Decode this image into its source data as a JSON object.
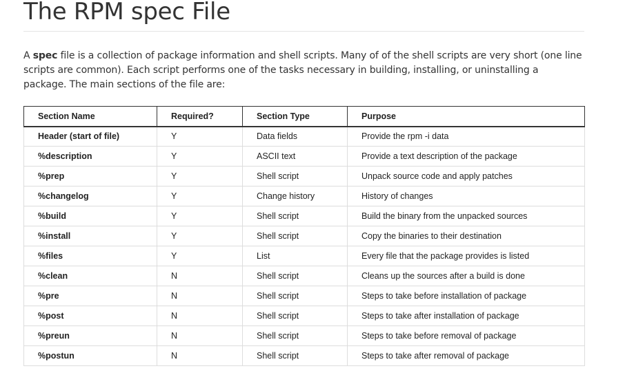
{
  "page": {
    "title": "The RPM spec File",
    "intro_prefix": "A ",
    "intro_bold": "spec",
    "intro_rest": " file is a collection of package information and shell scripts. Many of of the shell scripts are very short (one line scripts are common). Each script performs one of the tasks necessary in building, installing, or uninstalling a package. The main sections of the file are:"
  },
  "table": {
    "headers": [
      "Section Name",
      "Required?",
      "Section Type",
      "Purpose"
    ],
    "rows": [
      [
        "Header (start of file)",
        "Y",
        "Data fields",
        "Provide the rpm -i data"
      ],
      [
        "%description",
        "Y",
        "ASCII text",
        "Provide a text description of the package"
      ],
      [
        "%prep",
        "Y",
        "Shell script",
        "Unpack source code and apply patches"
      ],
      [
        "%changelog",
        "Y",
        "Change history",
        "History of changes"
      ],
      [
        "%build",
        "Y",
        "Shell script",
        "Build the binary from the unpacked sources"
      ],
      [
        "%install",
        "Y",
        "Shell script",
        "Copy the binaries to their destination"
      ],
      [
        "%files",
        "Y",
        "List",
        "Every file that the package provides is listed"
      ],
      [
        "%clean",
        "N",
        "Shell script",
        "Cleans up the sources after a build is done"
      ],
      [
        "%pre",
        "N",
        "Shell script",
        "Steps to take before installation of package"
      ],
      [
        "%post",
        "N",
        "Shell script",
        "Steps to take after installation of package"
      ],
      [
        "%preun",
        "N",
        "Shell script",
        "Steps to take before removal of package"
      ],
      [
        "%postun",
        "N",
        "Shell script",
        "Steps to take after removal of package"
      ]
    ]
  }
}
